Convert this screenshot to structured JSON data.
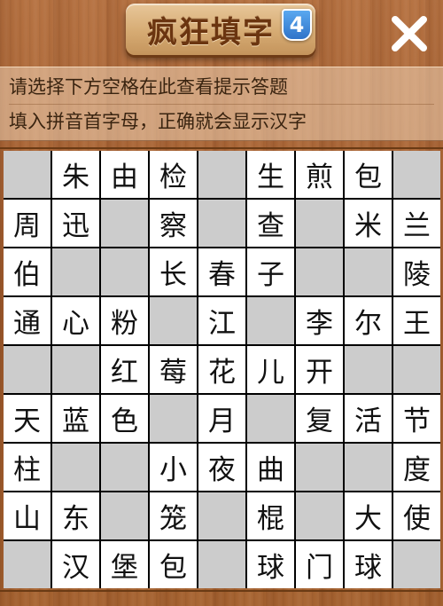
{
  "header": {
    "title": "疯狂填字",
    "level": "4",
    "close_icon": "close-icon"
  },
  "hints": {
    "line1": "请选择下方空格在此查看提示答题",
    "line2": "填入拼音首字母，正确就会显示汉字"
  },
  "colors": {
    "wood": "#a4612f",
    "empty_cell": "#cccccc",
    "filled_cell": "#ffffff",
    "badge_blue": "#2f74c9"
  },
  "grid": {
    "rows": [
      [
        "",
        "朱",
        "由",
        "检",
        "",
        "生",
        "煎",
        "包",
        ""
      ],
      [
        "周",
        "迅",
        "",
        "察",
        "",
        "查",
        "",
        "米",
        "兰"
      ],
      [
        "伯",
        "",
        "",
        "长",
        "春",
        "子",
        "",
        "",
        "陵"
      ],
      [
        "通",
        "心",
        "粉",
        "",
        "江",
        "",
        "李",
        "尔",
        "王"
      ],
      [
        "",
        "",
        "红",
        "莓",
        "花",
        "儿",
        "开",
        "",
        ""
      ],
      [
        "天",
        "蓝",
        "色",
        "",
        "月",
        "",
        "复",
        "活",
        "节"
      ],
      [
        "柱",
        "",
        "",
        "小",
        "夜",
        "曲",
        "",
        "",
        "度"
      ],
      [
        "山",
        "东",
        "",
        "笼",
        "",
        "棍",
        "",
        "大",
        "使"
      ],
      [
        "",
        "汉",
        "堡",
        "包",
        "",
        "球",
        "门",
        "球",
        ""
      ]
    ]
  }
}
